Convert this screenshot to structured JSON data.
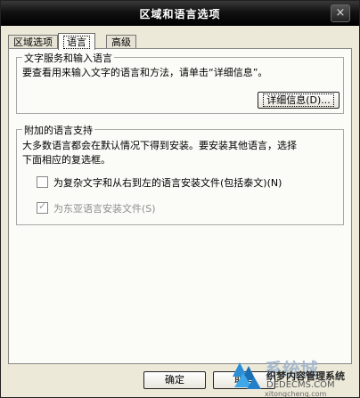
{
  "window": {
    "title": "区域和语言选项",
    "close_symbol": "×"
  },
  "tabs": [
    {
      "label": "区域选项",
      "active": false
    },
    {
      "label": "语言",
      "active": true
    },
    {
      "label": "高级",
      "active": false
    }
  ],
  "text_services": {
    "group_title": "文字服务和输入语言",
    "description": "要查看用来输入文字的语言和方法，请单击“详细信息”。",
    "details_button": "详细信息(D)..."
  },
  "supplemental": {
    "group_title": "附加的语言支持",
    "description_line1": "大多数语言都会在默认情况下得到安装。要安装其他语言，选择",
    "description_line2": "下面相应的复选框。",
    "checkbox_complex": {
      "label": "为复杂文字和从右到左的语言安装文件(包括泰文)(N)",
      "checked": false,
      "enabled": true
    },
    "checkbox_east_asian": {
      "label": "为东亚语言安装文件(S)",
      "checked": true,
      "enabled": false
    }
  },
  "footer": {
    "ok_button": "确定",
    "cancel_button": "取消"
  },
  "watermark": {
    "brand": "系统城",
    "site_name": "织梦内容管理系统",
    "site_url": "DEDECMS.COM",
    "domain": "xitongcheng.com"
  }
}
